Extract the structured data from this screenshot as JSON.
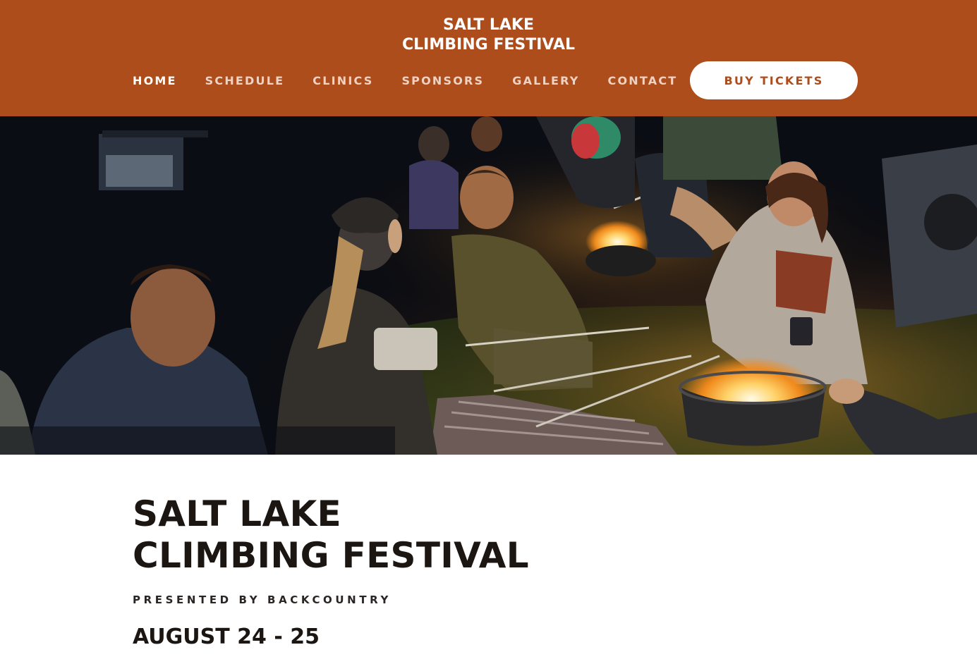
{
  "header": {
    "title_line1": "SALT LAKE",
    "title_line2": "CLIMBING FESTIVAL",
    "background_color": "#ad4d1c"
  },
  "nav": {
    "items": [
      {
        "label": "HOME",
        "active": true
      },
      {
        "label": "SCHEDULE",
        "active": false
      },
      {
        "label": "CLINICS",
        "active": false
      },
      {
        "label": "SPONSORS",
        "active": false
      },
      {
        "label": "GALLERY",
        "active": false
      },
      {
        "label": "CONTACT",
        "active": false
      }
    ],
    "cta_label": "BUY TICKETS"
  },
  "hero": {
    "image_subject": "campfire-night-photo"
  },
  "main": {
    "title_line1": "SALT LAKE",
    "title_line2": "CLIMBING FESTIVAL",
    "presented_by": "PRESENTED BY BACKCOUNTRY",
    "dates": "AUGUST 24 - 25"
  }
}
